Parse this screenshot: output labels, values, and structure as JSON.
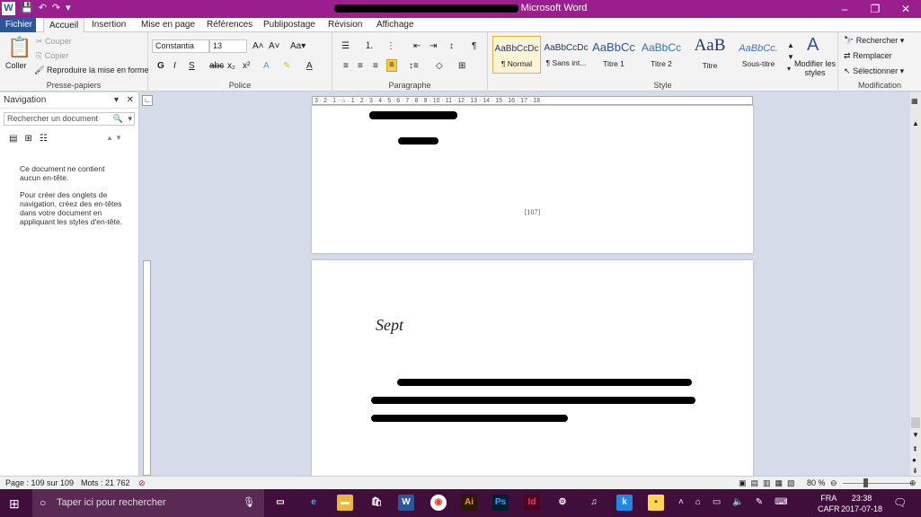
{
  "window": {
    "title_suffix": "Microsoft Word",
    "minimize": "–",
    "maximize": "❐",
    "close": "✕"
  },
  "tabs": [
    "Fichier",
    "Accueil",
    "Insertion",
    "Mise en page",
    "Références",
    "Publipostage",
    "Révision",
    "Affichage"
  ],
  "clipboard": {
    "paste": "Coller",
    "cut": "Couper",
    "copy": "Copier",
    "format_painter": "Reproduire la mise en forme",
    "label": "Presse-papiers"
  },
  "font": {
    "name": "Constantia",
    "size": "13",
    "label": "Police"
  },
  "paragraph": {
    "label": "Paragraphe"
  },
  "styles": {
    "label": "Style",
    "items": [
      {
        "preview": "AaBbCcDc",
        "name": "¶ Normal"
      },
      {
        "preview": "AaBbCcDc",
        "name": "¶ Sans int..."
      },
      {
        "preview": "AaBbCc",
        "name": "Titre 1"
      },
      {
        "preview": "AaBbCc",
        "name": "Titre 2"
      },
      {
        "preview": "AaB",
        "name": "Titre"
      },
      {
        "preview": "AaBbCc.",
        "name": "Sous-titre"
      }
    ],
    "modify": "Modifier les styles"
  },
  "editing": {
    "find": "Rechercher",
    "replace": "Remplacer",
    "select": "Sélectionner",
    "label": "Modification"
  },
  "navigation": {
    "title": "Navigation",
    "search_placeholder": "Rechercher un document",
    "msg1": "Ce document ne contient aucun en-tête.",
    "msg2": "Pour créer des onglets de navigation, créez des en-têtes dans votre document en appliquant les styles d'en-tête."
  },
  "document": {
    "page_number": "[107]",
    "chapter": "Sept"
  },
  "status": {
    "page": "Page : 109 sur 109",
    "words": "Mots : 21 762",
    "zoom": "80 %"
  },
  "taskbar": {
    "search": "Taper ici pour rechercher",
    "lang1": "FRA",
    "lang2": "CAFR",
    "time": "23:38",
    "date": "2017-07-18"
  },
  "colors": {
    "title_bar": "#9b1e8f",
    "taskbar": "#400e3a",
    "file_tab": "#2b579a"
  }
}
